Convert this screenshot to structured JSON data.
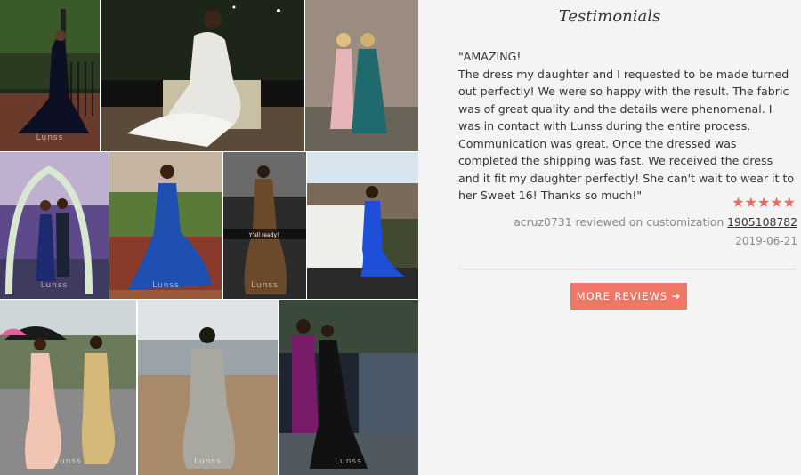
{
  "testimonials": {
    "title": "Testimonials",
    "quote": "\"AMAZING!\nThe dress my daughter and I requested to be made turned out perfectly! We were so happy with the result. The fabric was of great quality and the details were phenomenal. I was in contact with Lunss during the entire process. Communication was great. Once the dressed was completed the shipping was fast. We received the dress and it fit my daughter perfectly! She can't wait to wear it to her Sweet 16! Thanks so much!\"",
    "stars": "★★★★★",
    "rating": 5,
    "reviewer_text": "acruz0731 reviewed on customization",
    "product_id": "1905108782",
    "date": "2019-06-21",
    "more_button": "MORE REVIEWS ➔"
  },
  "gallery": {
    "watermark": "Lunss",
    "snap_caption": "Y'all ready?"
  },
  "colors": {
    "accent": "#ee7766",
    "star": "#e86d5c"
  }
}
